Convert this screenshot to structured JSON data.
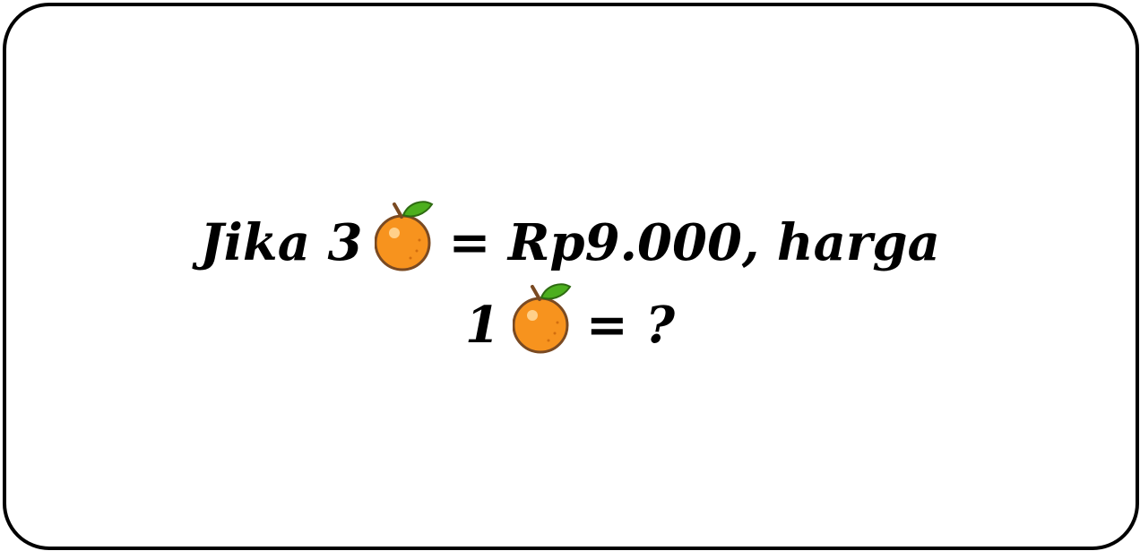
{
  "question": {
    "line1_prefix": "Jika 3",
    "line1_suffix": "= Rp9.000, harga",
    "line2_prefix": "1",
    "line2_suffix": "= ?",
    "fruit_icon": "orange-icon"
  },
  "colors": {
    "border": "#000000",
    "orange": "#F7931E",
    "leaf": "#4CAF1E",
    "stem": "#7A4A22"
  }
}
